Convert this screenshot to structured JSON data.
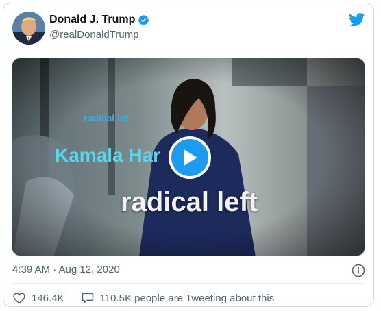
{
  "tweet": {
    "display_name": "Donald J. Trump",
    "handle": "@realDonaldTrump",
    "timestamp": "4:39 AM · Aug 12, 2020",
    "likes": "146.4K",
    "retweet_text": "110.5K people are Tweeting about this"
  },
  "video": {
    "overlay_small": "radical lef",
    "overlay_medium": "Kamala Har",
    "overlay_large": "radical left"
  },
  "colors": {
    "twitter_blue": "#1d9bf0",
    "verified_blue": "#1d9bf0",
    "secondary_text": "#536471"
  },
  "icons": {
    "verified": "verified-badge-icon",
    "brand": "twitter-bird-icon",
    "info": "info-icon",
    "like": "heart-icon",
    "retweet": "speech-bubble-icon",
    "play": "play-icon"
  }
}
